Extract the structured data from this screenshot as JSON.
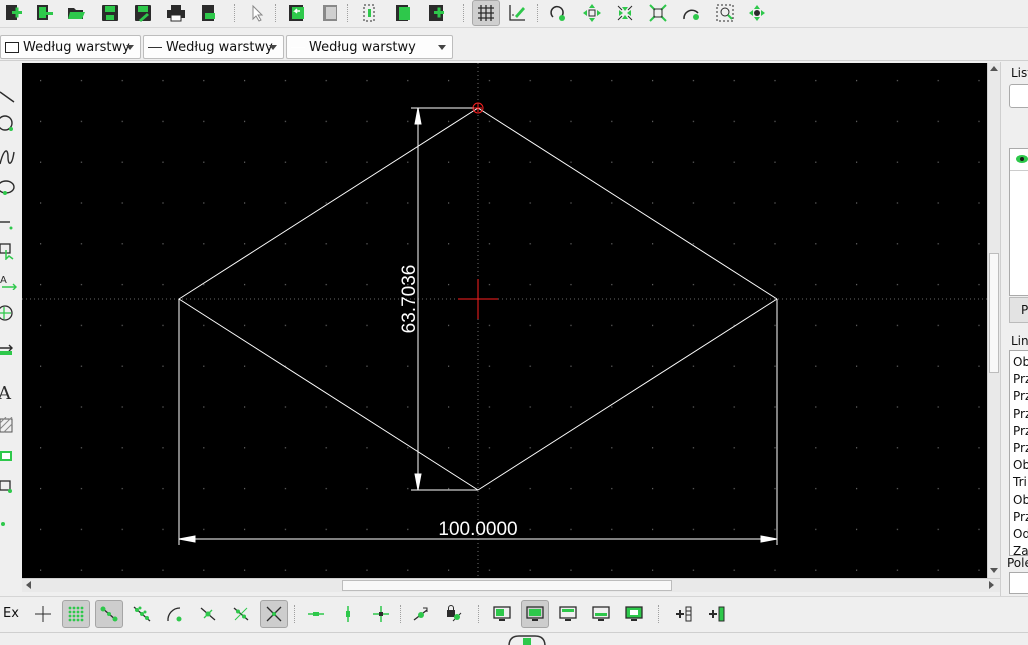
{
  "colors": {
    "canvas_bg": "#000000",
    "drawing_lines": "#ffffff",
    "crosshair": "#ff2020",
    "icon_green": "#2ec84b",
    "icon_dark": "#2b2b2b"
  },
  "toolbar_top": {
    "icons": [
      "new-file-icon",
      "new-from-template-icon",
      "open-file-icon",
      "save-icon",
      "save-as-icon",
      "print-icon",
      "print-preview-icon",
      "select-pointer-icon",
      "undo-icon",
      "redo-icon",
      "cut-icon",
      "copy-icon",
      "paste-icon",
      "grid-icon",
      "draft-mode-icon",
      "zoom-redraw-icon",
      "zoom-in-icon",
      "zoom-out-icon",
      "zoom-auto-icon",
      "zoom-previous-icon",
      "zoom-window-icon",
      "zoom-pan-icon"
    ]
  },
  "property_bar": {
    "color_combo": "Według warstwy",
    "linewidth_combo": "Według warstwy",
    "linetype_combo": "Według warstwy"
  },
  "left_toolbar": {
    "icons": [
      "line-tool-icon",
      "circle-tool-icon",
      "spline-tool-icon",
      "ellipse-tool-icon",
      "polyline-tool-icon",
      "select-tool-icon",
      "dimension-tool-icon",
      "modify-tool-icon",
      "measure-tool-icon",
      "text-tool-icon",
      "hatch-tool-icon",
      "image-tool-icon",
      "block-tool-icon",
      "point-tool-icon"
    ],
    "text_icon_glyph": "A"
  },
  "drawing": {
    "vertical_dimension": "63.7036",
    "horizontal_dimension": "100.0000"
  },
  "right_dock": {
    "layer_list_label": "List",
    "layer_button": "P",
    "command_list_label": "Lin",
    "command_history": [
      "Ob",
      "Prz",
      "Prz",
      "Prz",
      "Prz",
      "Prz",
      "Ob",
      "Tri",
      "Ob",
      "Prz",
      "Od",
      "Zar"
    ],
    "command_input_label": "Pole"
  },
  "snap_toolbar": {
    "label": "Ex",
    "icons": [
      "snap-free-icon",
      "snap-grid-icon",
      "snap-endpoint-icon",
      "snap-on-entity-icon",
      "snap-center-icon",
      "snap-middle-icon",
      "snap-distance-icon",
      "snap-intersection-icon",
      "restrict-horizontal-icon",
      "restrict-vertical-icon",
      "restrict-orthogonal-icon",
      "relative-zero-icon",
      "lock-relative-zero-icon",
      "view-1-icon",
      "view-2-icon",
      "view-3-icon",
      "view-4-icon",
      "view-5-icon",
      "insert-row-icon",
      "insert-column-icon"
    ]
  }
}
